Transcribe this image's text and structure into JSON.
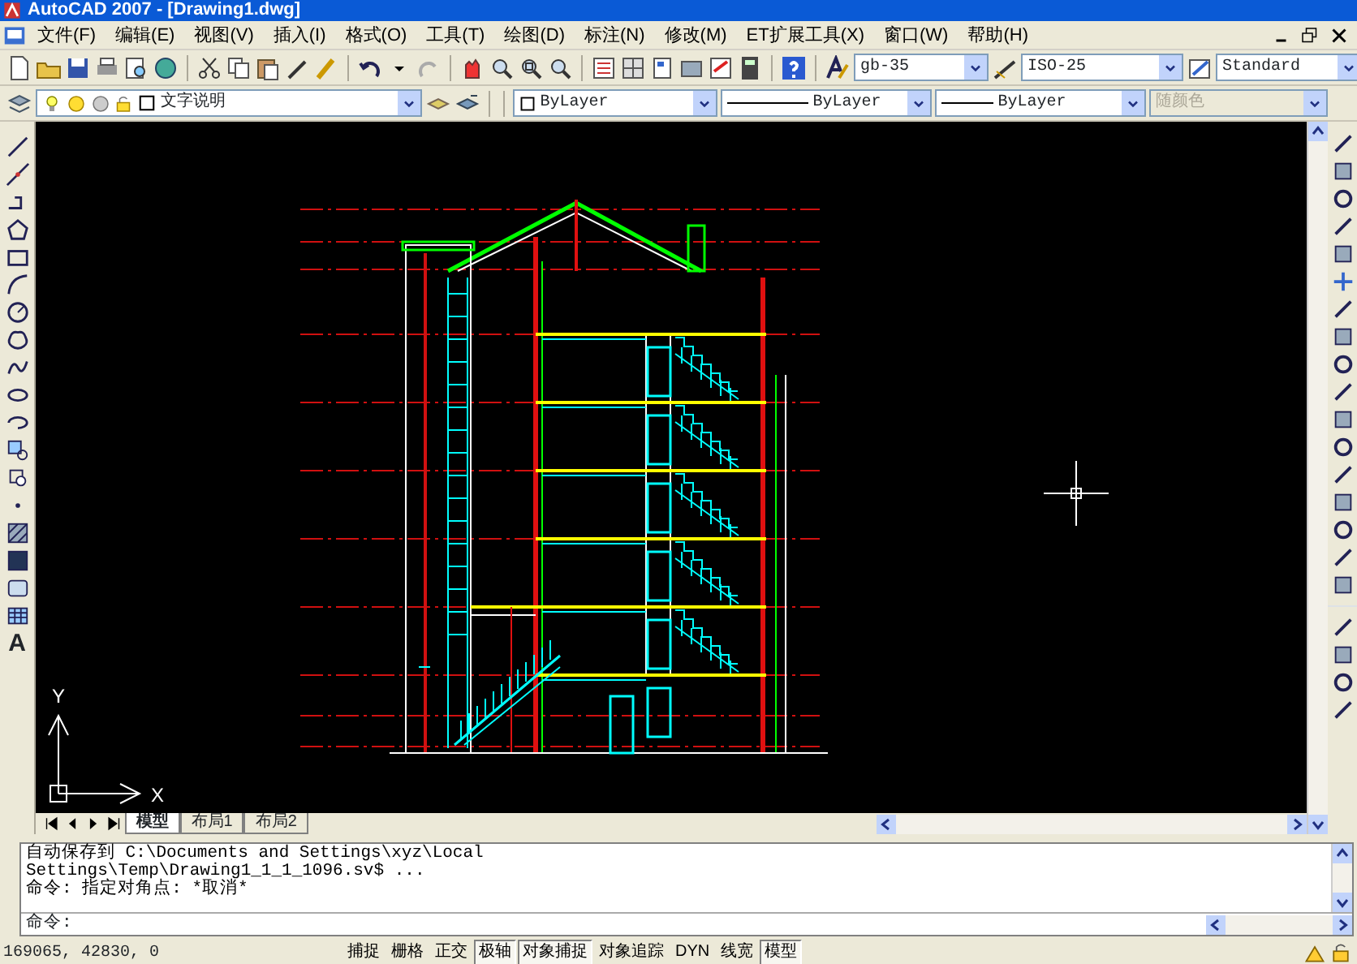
{
  "window": {
    "title": "AutoCAD 2007 - [Drawing1.dwg]"
  },
  "menu": [
    "文件(F)",
    "编辑(E)",
    "视图(V)",
    "插入(I)",
    "格式(O)",
    "工具(T)",
    "绘图(D)",
    "标注(N)",
    "修改(M)",
    "ET扩展工具(X)",
    "窗口(W)",
    "帮助(H)"
  ],
  "styles_toolbar": {
    "text_style": "gb-35",
    "dim_style": "ISO-25",
    "table_style": "Standard"
  },
  "properties_toolbar": {
    "layer": "文字说明",
    "color_setting": "ByLayer",
    "linetype": "ByLayer",
    "lineweight": "ByLayer",
    "plot_style": {
      "value": "随颜色",
      "disabled": true
    }
  },
  "draw_toolbar": {
    "text_tool_glyph": "A"
  },
  "ucs_icon": {
    "x_label": "X",
    "y_label": "Y"
  },
  "layout_tabs": [
    {
      "label": "模型",
      "selected": true
    },
    {
      "label": "布局1",
      "selected": false
    },
    {
      "label": "布局2",
      "selected": false
    }
  ],
  "command_window": {
    "history": [
      "自动保存到 C:\\Documents and Settings\\xyz\\Local",
      "Settings\\Temp\\Drawing1_1_1_1096.sv$ ...",
      "命令: 指定对角点: *取消*"
    ],
    "prompt": "命令:"
  },
  "status_bar": {
    "coordinates": "169065, 42830, 0",
    "toggles": [
      {
        "label": "捕捉",
        "on": false
      },
      {
        "label": "栅格",
        "on": false
      },
      {
        "label": "正交",
        "on": false
      },
      {
        "label": "极轴",
        "on": true
      },
      {
        "label": "对象捕捉",
        "on": true
      },
      {
        "label": "对象追踪",
        "on": false
      },
      {
        "label": "DYN",
        "on": false
      },
      {
        "label": "线宽",
        "on": false
      },
      {
        "label": "模型",
        "on": true
      }
    ]
  }
}
